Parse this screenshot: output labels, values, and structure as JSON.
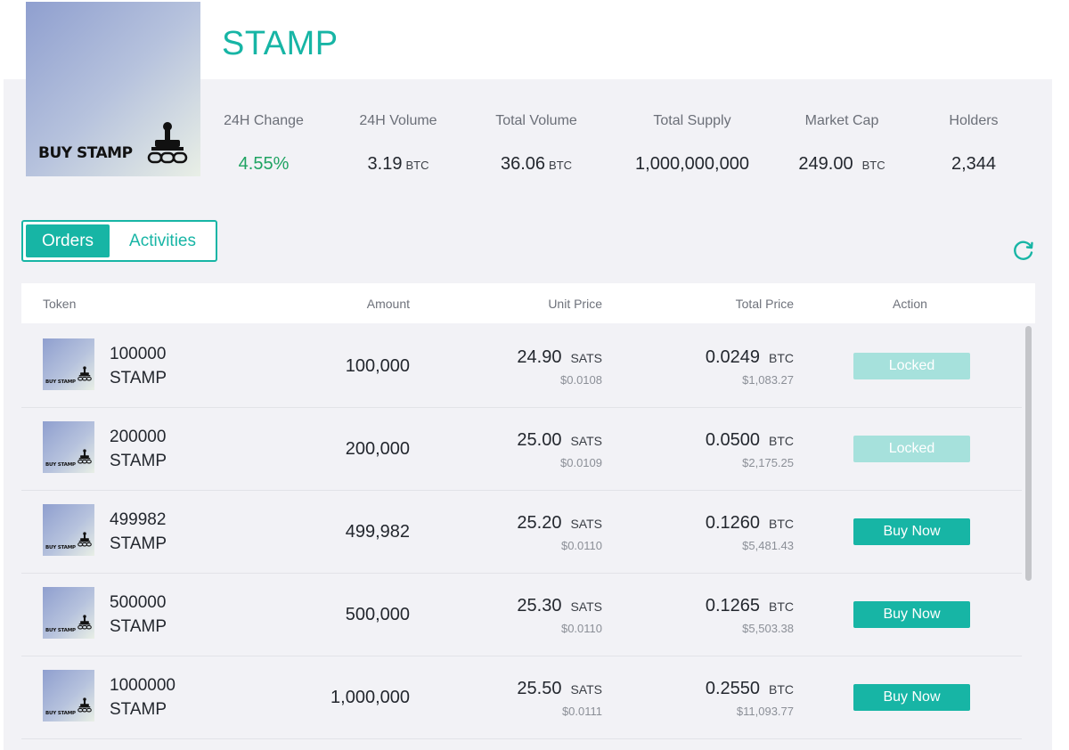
{
  "token": {
    "name": "STAMP",
    "logo_text": "BUY STAMP"
  },
  "stats": [
    {
      "label": "24H Change",
      "value": "4.55%",
      "unit": ""
    },
    {
      "label": "24H Volume",
      "value": "3.19",
      "unit": "BTC"
    },
    {
      "label": "Total Volume",
      "value": "36.06",
      "unit": "BTC"
    },
    {
      "label": "Total Supply",
      "value": "1,000,000,000",
      "unit": ""
    },
    {
      "label": "Market Cap",
      "value": "249.00",
      "unit": "BTC"
    },
    {
      "label": "Holders",
      "value": "2,344",
      "unit": ""
    }
  ],
  "tabs": {
    "orders": "Orders",
    "activities": "Activities"
  },
  "table": {
    "headers": {
      "token": "Token",
      "amount": "Amount",
      "unit_price": "Unit Price",
      "total_price": "Total Price",
      "action": "Action"
    },
    "rows": [
      {
        "qty": "100000",
        "ticker": "STAMP",
        "amount": "100,000",
        "unit_price": "24.90",
        "unit_cur": "SATS",
        "unit_usd": "$0.0108",
        "total_price": "0.0249",
        "total_cur": "BTC",
        "total_usd": "$1,083.27",
        "action": "Locked",
        "state": "locked"
      },
      {
        "qty": "200000",
        "ticker": "STAMP",
        "amount": "200,000",
        "unit_price": "25.00",
        "unit_cur": "SATS",
        "unit_usd": "$0.0109",
        "total_price": "0.0500",
        "total_cur": "BTC",
        "total_usd": "$2,175.25",
        "action": "Locked",
        "state": "locked"
      },
      {
        "qty": "499982",
        "ticker": "STAMP",
        "amount": "499,982",
        "unit_price": "25.20",
        "unit_cur": "SATS",
        "unit_usd": "$0.0110",
        "total_price": "0.1260",
        "total_cur": "BTC",
        "total_usd": "$5,481.43",
        "action": "Buy Now",
        "state": "buy"
      },
      {
        "qty": "500000",
        "ticker": "STAMP",
        "amount": "500,000",
        "unit_price": "25.30",
        "unit_cur": "SATS",
        "unit_usd": "$0.0110",
        "total_price": "0.1265",
        "total_cur": "BTC",
        "total_usd": "$5,503.38",
        "action": "Buy Now",
        "state": "buy"
      },
      {
        "qty": "1000000",
        "ticker": "STAMP",
        "amount": "1,000,000",
        "unit_price": "25.50",
        "unit_cur": "SATS",
        "unit_usd": "$0.0111",
        "total_price": "0.2550",
        "total_cur": "BTC",
        "total_usd": "$11,093.77",
        "action": "Buy Now",
        "state": "buy"
      }
    ]
  },
  "icons": {
    "refresh": "refresh-icon",
    "stamp": "stamp-icon"
  },
  "colors": {
    "accent": "#17b5a5",
    "positive": "#1fa362",
    "locked": "#a6e1dc"
  }
}
